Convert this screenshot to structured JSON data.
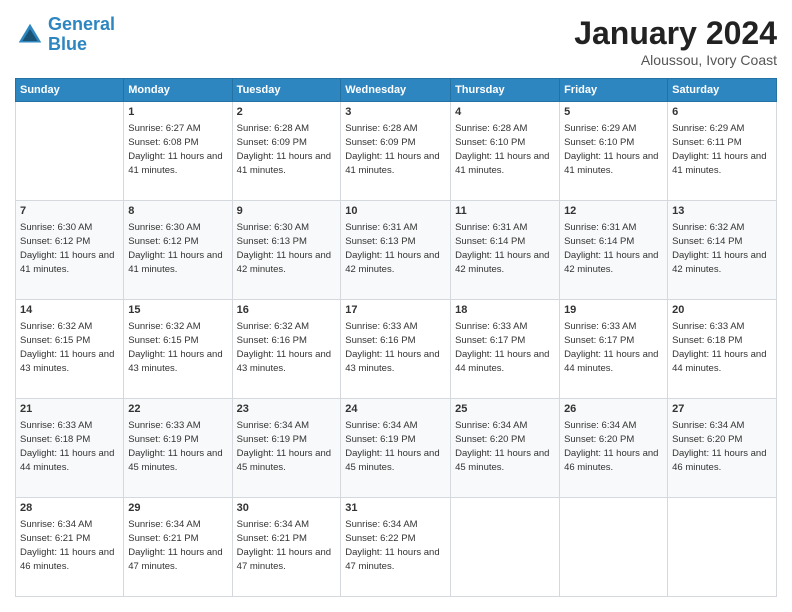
{
  "header": {
    "logo_line1": "General",
    "logo_line2": "Blue",
    "month_year": "January 2024",
    "location": "Aloussou, Ivory Coast"
  },
  "days_of_week": [
    "Sunday",
    "Monday",
    "Tuesday",
    "Wednesday",
    "Thursday",
    "Friday",
    "Saturday"
  ],
  "weeks": [
    [
      {
        "day": "",
        "sunrise": "",
        "sunset": "",
        "daylight": ""
      },
      {
        "day": "1",
        "sunrise": "Sunrise: 6:27 AM",
        "sunset": "Sunset: 6:08 PM",
        "daylight": "Daylight: 11 hours and 41 minutes."
      },
      {
        "day": "2",
        "sunrise": "Sunrise: 6:28 AM",
        "sunset": "Sunset: 6:09 PM",
        "daylight": "Daylight: 11 hours and 41 minutes."
      },
      {
        "day": "3",
        "sunrise": "Sunrise: 6:28 AM",
        "sunset": "Sunset: 6:09 PM",
        "daylight": "Daylight: 11 hours and 41 minutes."
      },
      {
        "day": "4",
        "sunrise": "Sunrise: 6:28 AM",
        "sunset": "Sunset: 6:10 PM",
        "daylight": "Daylight: 11 hours and 41 minutes."
      },
      {
        "day": "5",
        "sunrise": "Sunrise: 6:29 AM",
        "sunset": "Sunset: 6:10 PM",
        "daylight": "Daylight: 11 hours and 41 minutes."
      },
      {
        "day": "6",
        "sunrise": "Sunrise: 6:29 AM",
        "sunset": "Sunset: 6:11 PM",
        "daylight": "Daylight: 11 hours and 41 minutes."
      }
    ],
    [
      {
        "day": "7",
        "sunrise": "Sunrise: 6:30 AM",
        "sunset": "Sunset: 6:12 PM",
        "daylight": "Daylight: 11 hours and 41 minutes."
      },
      {
        "day": "8",
        "sunrise": "Sunrise: 6:30 AM",
        "sunset": "Sunset: 6:12 PM",
        "daylight": "Daylight: 11 hours and 41 minutes."
      },
      {
        "day": "9",
        "sunrise": "Sunrise: 6:30 AM",
        "sunset": "Sunset: 6:13 PM",
        "daylight": "Daylight: 11 hours and 42 minutes."
      },
      {
        "day": "10",
        "sunrise": "Sunrise: 6:31 AM",
        "sunset": "Sunset: 6:13 PM",
        "daylight": "Daylight: 11 hours and 42 minutes."
      },
      {
        "day": "11",
        "sunrise": "Sunrise: 6:31 AM",
        "sunset": "Sunset: 6:14 PM",
        "daylight": "Daylight: 11 hours and 42 minutes."
      },
      {
        "day": "12",
        "sunrise": "Sunrise: 6:31 AM",
        "sunset": "Sunset: 6:14 PM",
        "daylight": "Daylight: 11 hours and 42 minutes."
      },
      {
        "day": "13",
        "sunrise": "Sunrise: 6:32 AM",
        "sunset": "Sunset: 6:14 PM",
        "daylight": "Daylight: 11 hours and 42 minutes."
      }
    ],
    [
      {
        "day": "14",
        "sunrise": "Sunrise: 6:32 AM",
        "sunset": "Sunset: 6:15 PM",
        "daylight": "Daylight: 11 hours and 43 minutes."
      },
      {
        "day": "15",
        "sunrise": "Sunrise: 6:32 AM",
        "sunset": "Sunset: 6:15 PM",
        "daylight": "Daylight: 11 hours and 43 minutes."
      },
      {
        "day": "16",
        "sunrise": "Sunrise: 6:32 AM",
        "sunset": "Sunset: 6:16 PM",
        "daylight": "Daylight: 11 hours and 43 minutes."
      },
      {
        "day": "17",
        "sunrise": "Sunrise: 6:33 AM",
        "sunset": "Sunset: 6:16 PM",
        "daylight": "Daylight: 11 hours and 43 minutes."
      },
      {
        "day": "18",
        "sunrise": "Sunrise: 6:33 AM",
        "sunset": "Sunset: 6:17 PM",
        "daylight": "Daylight: 11 hours and 44 minutes."
      },
      {
        "day": "19",
        "sunrise": "Sunrise: 6:33 AM",
        "sunset": "Sunset: 6:17 PM",
        "daylight": "Daylight: 11 hours and 44 minutes."
      },
      {
        "day": "20",
        "sunrise": "Sunrise: 6:33 AM",
        "sunset": "Sunset: 6:18 PM",
        "daylight": "Daylight: 11 hours and 44 minutes."
      }
    ],
    [
      {
        "day": "21",
        "sunrise": "Sunrise: 6:33 AM",
        "sunset": "Sunset: 6:18 PM",
        "daylight": "Daylight: 11 hours and 44 minutes."
      },
      {
        "day": "22",
        "sunrise": "Sunrise: 6:33 AM",
        "sunset": "Sunset: 6:19 PM",
        "daylight": "Daylight: 11 hours and 45 minutes."
      },
      {
        "day": "23",
        "sunrise": "Sunrise: 6:34 AM",
        "sunset": "Sunset: 6:19 PM",
        "daylight": "Daylight: 11 hours and 45 minutes."
      },
      {
        "day": "24",
        "sunrise": "Sunrise: 6:34 AM",
        "sunset": "Sunset: 6:19 PM",
        "daylight": "Daylight: 11 hours and 45 minutes."
      },
      {
        "day": "25",
        "sunrise": "Sunrise: 6:34 AM",
        "sunset": "Sunset: 6:20 PM",
        "daylight": "Daylight: 11 hours and 45 minutes."
      },
      {
        "day": "26",
        "sunrise": "Sunrise: 6:34 AM",
        "sunset": "Sunset: 6:20 PM",
        "daylight": "Daylight: 11 hours and 46 minutes."
      },
      {
        "day": "27",
        "sunrise": "Sunrise: 6:34 AM",
        "sunset": "Sunset: 6:20 PM",
        "daylight": "Daylight: 11 hours and 46 minutes."
      }
    ],
    [
      {
        "day": "28",
        "sunrise": "Sunrise: 6:34 AM",
        "sunset": "Sunset: 6:21 PM",
        "daylight": "Daylight: 11 hours and 46 minutes."
      },
      {
        "day": "29",
        "sunrise": "Sunrise: 6:34 AM",
        "sunset": "Sunset: 6:21 PM",
        "daylight": "Daylight: 11 hours and 47 minutes."
      },
      {
        "day": "30",
        "sunrise": "Sunrise: 6:34 AM",
        "sunset": "Sunset: 6:21 PM",
        "daylight": "Daylight: 11 hours and 47 minutes."
      },
      {
        "day": "31",
        "sunrise": "Sunrise: 6:34 AM",
        "sunset": "Sunset: 6:22 PM",
        "daylight": "Daylight: 11 hours and 47 minutes."
      },
      {
        "day": "",
        "sunrise": "",
        "sunset": "",
        "daylight": ""
      },
      {
        "day": "",
        "sunrise": "",
        "sunset": "",
        "daylight": ""
      },
      {
        "day": "",
        "sunrise": "",
        "sunset": "",
        "daylight": ""
      }
    ]
  ]
}
